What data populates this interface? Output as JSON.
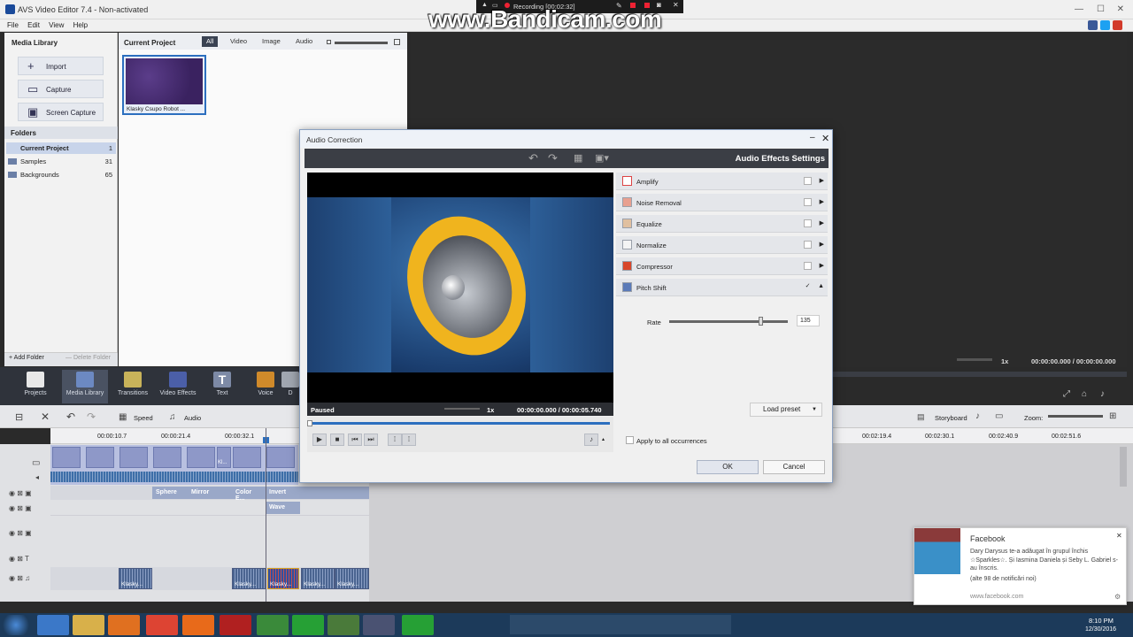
{
  "window": {
    "title": "AVS Video Editor 7.4 - Non-activated"
  },
  "menu": [
    "File",
    "Edit",
    "View",
    "Help"
  ],
  "bandicam": {
    "status": "Recording [00:02:32]",
    "watermark": "www.Bandicam.com"
  },
  "media_library": {
    "title": "Media Library",
    "buttons": [
      {
        "label": "Import"
      },
      {
        "label": "Capture"
      },
      {
        "label": "Screen Capture"
      }
    ],
    "folders_title": "Folders",
    "folders": [
      {
        "name": "Current Project",
        "count": "1"
      },
      {
        "name": "Samples",
        "count": "31"
      },
      {
        "name": "Backgrounds",
        "count": "65"
      }
    ],
    "add_folder": "+ Add Folder",
    "delete_folder": "— Delete Folder"
  },
  "project": {
    "title": "Current Project",
    "tabs": [
      "All",
      "Video",
      "Image",
      "Audio"
    ],
    "thumb_caption": "Klasky Csupo Robot ..."
  },
  "preview": {
    "speed": "1x",
    "time": "00:00:00.000 / 00:00:00.000"
  },
  "toolbar": [
    {
      "label": "Projects"
    },
    {
      "label": "Media Library"
    },
    {
      "label": "Transitions"
    },
    {
      "label": "Video Effects"
    },
    {
      "label": "Text"
    },
    {
      "label": "Voice"
    },
    {
      "label": "D"
    }
  ],
  "controls": {
    "speed": "Speed",
    "audio": "Audio",
    "storyboard": "Storyboard",
    "zoom": "Zoom:"
  },
  "ruler": [
    "00:00:10.7",
    "00:00:21.4",
    "00:00:32.1",
    "00:02:19.4",
    "00:02:30.1",
    "00:02:40.9",
    "00:02:51.6"
  ],
  "effects_track": [
    "Sphere",
    "Mirror",
    "Color E...",
    "Invert"
  ],
  "effects_track2": [
    "Wave"
  ],
  "audio_clips": [
    "Klasky...",
    "Klasky...",
    "Klasky...",
    "Klasky...",
    "Klasky..."
  ],
  "clip_label": "Kl...",
  "dialog": {
    "title": "Audio Correction",
    "header": "Audio Effects Settings",
    "status": "Paused",
    "speed": "1x",
    "time": "00:00:00.000 / 00:00:05.740",
    "effects": [
      {
        "name": "Amplify",
        "checked": ""
      },
      {
        "name": "Noise Removal",
        "checked": ""
      },
      {
        "name": "Equalize",
        "checked": ""
      },
      {
        "name": "Normalize",
        "checked": ""
      },
      {
        "name": "Compressor",
        "checked": ""
      },
      {
        "name": "Pitch Shift",
        "checked": "✓"
      }
    ],
    "rate_label": "Rate",
    "rate_value": "135",
    "rate_fraction": 0.77,
    "load_preset": "Load preset",
    "apply_all": "Apply to all occurrences",
    "ok": "OK",
    "cancel": "Cancel"
  },
  "facebook": {
    "title": "Facebook",
    "body": "Dary Darysus te-a adăugat în grupul închis ☆Sparkles☆. Și Iasmina Daniela și Seby L. Gabriel s-au înscris.",
    "more": "(alte 98 de notificări noi)",
    "url": "www.facebook.com"
  },
  "taskbar": {
    "time": "8:10 PM",
    "date": "12/30/2016"
  }
}
